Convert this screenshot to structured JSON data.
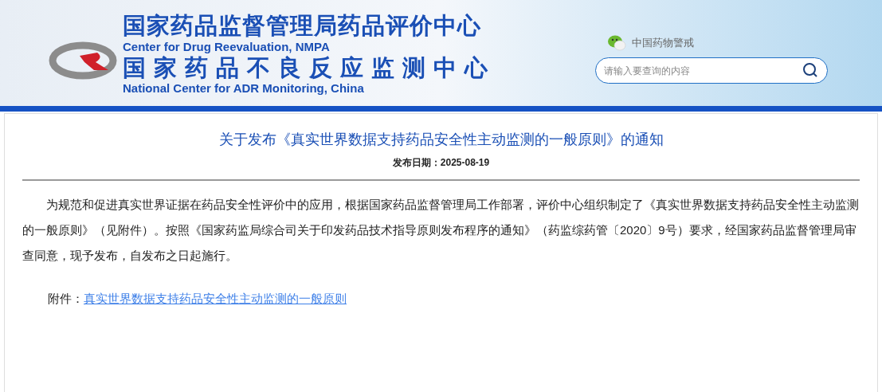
{
  "header": {
    "title_cn": "国家药品监督管理局药品评价中心",
    "title_en": "Center for Drug Reevaluation, NMPA",
    "subtitle_cn": "国家药品不良反应监测中心",
    "subtitle_en": "National Center for ADR Monitoring, China",
    "wechat_label": "中国药物警戒",
    "search": {
      "placeholder": "请输入要查询的内容"
    }
  },
  "article": {
    "title": "关于发布《真实世界数据支持药品安全性主动监测的一般原则》的通知",
    "date": "发布日期：2025-08-19",
    "paragraphs": [
      "为规范和促进真实世界证据在药品安全性评价中的应用，根据国家药品监督管理局工作部署，评价中心组织制定了《真实世界数据支持药品安全性主动监测的一般原则》（见附件）。按照《国家药监局综合司关于印发药品技术指导原则发布程序的通知》（药监综药管〔2020〕9号）要求，经国家药品监督管理局审查同意，现予发布，自发布之日起施行。"
    ],
    "attachment": {
      "label": "附件：",
      "link": "真实世界数据支持药品安全性主动监测的一般原则"
    }
  }
}
